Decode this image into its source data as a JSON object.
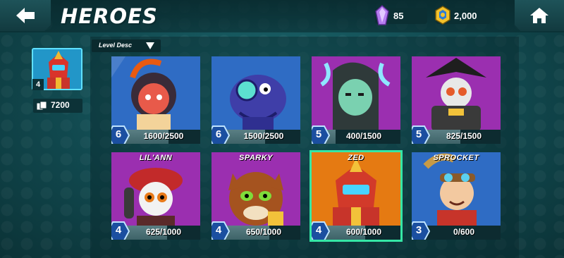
{
  "header": {
    "title": "HEROES",
    "back_icon": "back-arrow-icon",
    "home_icon": "home-icon"
  },
  "currency": {
    "gems": {
      "icon": "purple-gem-icon",
      "value": "85"
    },
    "coins": {
      "icon": "gold-coin-icon",
      "value": "2,000"
    }
  },
  "selected_hero": {
    "level": "4",
    "cards_icon": "cards-stack-icon",
    "cards": "7200"
  },
  "sort": {
    "label": "Level Desc",
    "icon": "triangle-down-icon"
  },
  "heroes": [
    {
      "name": "",
      "level": "6",
      "progress": "1600/2500",
      "fill": 0.64,
      "bg": "#2f6cc4"
    },
    {
      "name": "",
      "level": "6",
      "progress": "1500/2500",
      "fill": 0.6,
      "bg": "#2f6cc4"
    },
    {
      "name": "",
      "level": "5",
      "progress": "400/1500",
      "fill": 0.27,
      "bg": "#9b2fb0"
    },
    {
      "name": "",
      "level": "5",
      "progress": "825/1500",
      "fill": 0.55,
      "bg": "#9b2fb0"
    },
    {
      "name": "LIL'ANN",
      "level": "4",
      "progress": "625/1000",
      "fill": 0.625,
      "bg": "#9b2fb0"
    },
    {
      "name": "SPARKY",
      "level": "4",
      "progress": "650/1000",
      "fill": 0.65,
      "bg": "#9b2fb0"
    },
    {
      "name": "ZED",
      "level": "4",
      "progress": "600/1000",
      "fill": 0.6,
      "bg": "#e57a12",
      "selected": true
    },
    {
      "name": "SPROCKET",
      "level": "3",
      "progress": "0/600",
      "fill": 0,
      "bg": "#2f6cc4"
    }
  ],
  "colors": {
    "accent_teal": "#35e7a6",
    "blue_card": "#2f6cc4",
    "purple_card": "#9b2fb0",
    "orange_card": "#e57a12"
  }
}
